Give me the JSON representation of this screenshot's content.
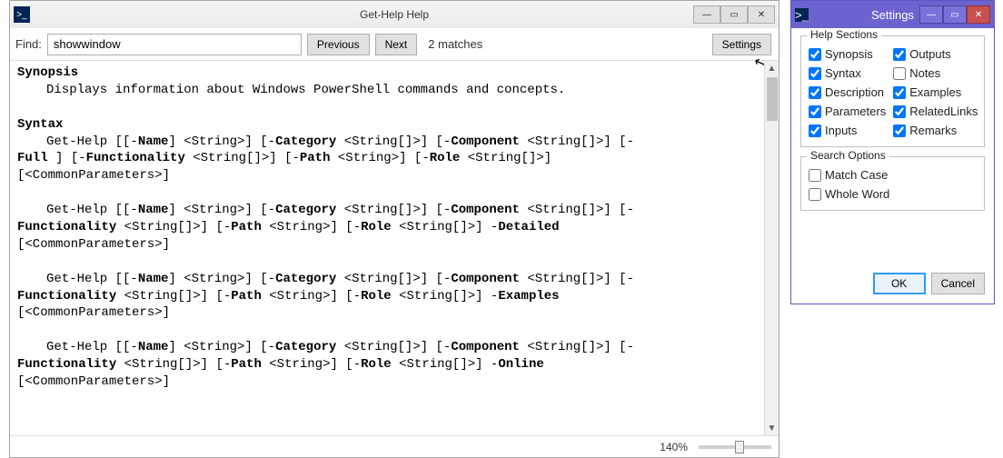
{
  "mainWindow": {
    "title": "Get-Help Help",
    "findLabel": "Find:",
    "findValue": "showwindow",
    "prevLabel": "Previous",
    "nextLabel": "Next",
    "matchText": "2 matches",
    "settingsLabel": "Settings",
    "zoomText": "140%"
  },
  "help": {
    "synopsisTitle": "Synopsis",
    "synopsisBody": "Displays information about Windows PowerShell commands and concepts.",
    "syntaxTitle": "Syntax",
    "cmd": "Get-Help",
    "kw": {
      "name": "Name",
      "category": "Category",
      "component": "Component",
      "full": "Full",
      "functionality": "Functionality",
      "path": "Path",
      "role": "Role",
      "detailed": "Detailed",
      "examples": "Examples",
      "online": "Online"
    },
    "types": {
      "str": "<String>",
      "strArr": "<String[]>"
    },
    "common": "[<CommonParameters>]"
  },
  "settingsWindow": {
    "title": "Settings",
    "helpSectionsTitle": "Help Sections",
    "sections": [
      {
        "label": "Synopsis",
        "checked": true
      },
      {
        "label": "Outputs",
        "checked": true
      },
      {
        "label": "Syntax",
        "checked": true
      },
      {
        "label": "Notes",
        "checked": false
      },
      {
        "label": "Description",
        "checked": true
      },
      {
        "label": "Examples",
        "checked": true
      },
      {
        "label": "Parameters",
        "checked": true
      },
      {
        "label": "RelatedLinks",
        "checked": true
      },
      {
        "label": "Inputs",
        "checked": true
      },
      {
        "label": "Remarks",
        "checked": true
      }
    ],
    "searchOptionsTitle": "Search Options",
    "searchOptions": [
      {
        "label": "Match Case",
        "checked": false
      },
      {
        "label": "Whole Word",
        "checked": false
      }
    ],
    "okLabel": "OK",
    "cancelLabel": "Cancel"
  }
}
